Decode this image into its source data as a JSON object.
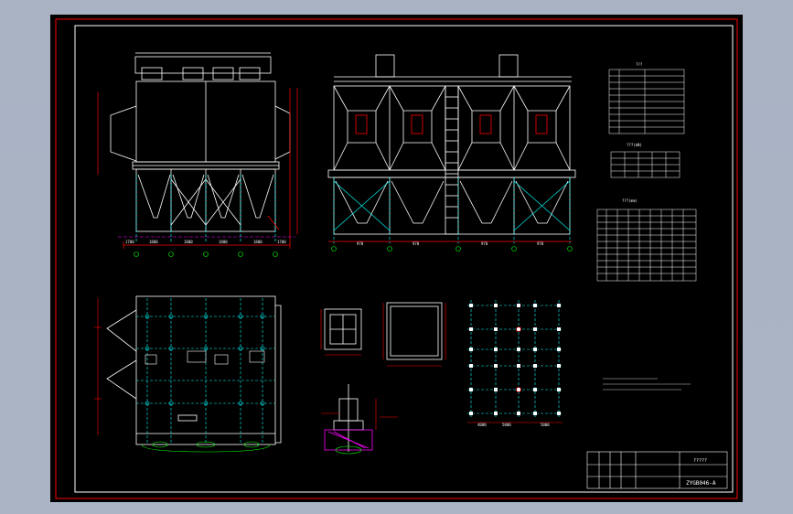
{
  "drawing": {
    "background_color": "#000000",
    "frame_color": "#ff0000",
    "line_colors": {
      "structure": "#ffffff",
      "dimension": "#ff0000",
      "centerline": "#00ffff",
      "hatch": "#ff00ff",
      "table_grid": "#ffff00",
      "ground": "#00ff00"
    }
  },
  "title_block": {
    "drawing_number": "ZYGB046-A",
    "drawing_title": "?????"
  },
  "front_view": {
    "dims": [
      "1700",
      "1800",
      "1800",
      "1800",
      "1800",
      "1700"
    ]
  },
  "side_view": {
    "dims": [
      "970",
      "970",
      "970",
      "970"
    ]
  },
  "plan_view": {
    "dims": [
      "4000",
      "5000"
    ]
  },
  "foundation_plan": {
    "dims": [
      "4000",
      "5000",
      "5000"
    ]
  },
  "table_headers": {
    "spec_table": "???",
    "load_table": "???(kN)",
    "section_table": "???(mm)"
  }
}
